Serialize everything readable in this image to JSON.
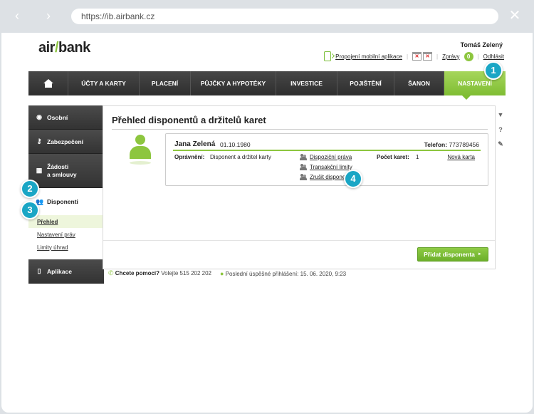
{
  "browser": {
    "back": "‹",
    "forward": "›",
    "url": "https://ib.airbank.cz",
    "close": "✕"
  },
  "header": {
    "logo_left": "air",
    "logo_slash": "/",
    "logo_right": "bank",
    "user_name": "Tomáš Zelený",
    "mobile_link": "Propojení mobilní aplikace",
    "messages_link": "Zprávy",
    "messages_count": "0",
    "logout_link": "Odhlásit",
    "calendar_marks": [
      "✕",
      "✕"
    ]
  },
  "mainnav": {
    "home": "home",
    "items": [
      "ÚČTY A KARTY",
      "PLACENÍ",
      "PŮJČKY A HYPOTÉKY",
      "INVESTICE",
      "POJIŠTĚNÍ",
      "ŠANON",
      "NASTAVENÍ"
    ],
    "active_index": 6
  },
  "sidebar": {
    "items": [
      {
        "label": "Osobní",
        "icon": "eye-icon"
      },
      {
        "label": "Zabezpečení",
        "icon": "key-icon"
      },
      {
        "label_line1": "Žádosti",
        "label_line2": "a smlouvy",
        "icon": "grid-icon"
      },
      {
        "label": "Disponenti",
        "icon": "people-icon"
      }
    ],
    "subitems": [
      "Přehled",
      "Nastavení práv",
      "Limity úhrad"
    ],
    "bottom": {
      "label": "Aplikace",
      "icon": "phone-icon"
    }
  },
  "content": {
    "title": "Přehled disponentů a držitelů karet",
    "card": {
      "name": "Jana Zelená",
      "dob": "01.10.1980",
      "phone_label": "Telefon:",
      "phone": "773789456",
      "perm_label": "Oprávnění:",
      "perm_value": "Disponent a držitel karty",
      "actions": [
        "Dispoziční práva",
        "Transakční limity",
        "Zrušit disponenta"
      ],
      "count_label": "Počet karet:",
      "count_value": "1",
      "new_card": "Nová karta"
    },
    "add_button": "Přidat disponenta",
    "add_button_arrow": "►"
  },
  "footer": {
    "help_bold": "Chcete pomoci?",
    "help_text": "Volejte 515 202 202",
    "last_login": "Poslední úspěšné přihlášení: 15. 06. 2020, 9:23"
  },
  "rail": [
    "pin-icon",
    "help-icon",
    "edit-icon"
  ],
  "steps": [
    "1",
    "2",
    "3",
    "4"
  ],
  "colors": {
    "accent": "#8dc63f",
    "step": "#1aa6c5",
    "nav_dark": "#3a3a3a"
  }
}
